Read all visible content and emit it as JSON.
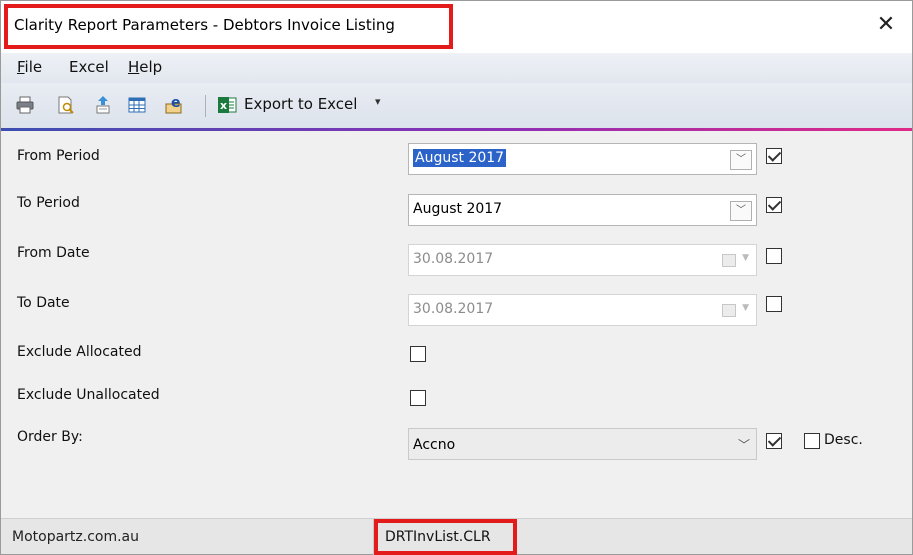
{
  "window": {
    "title": "Clarity Report Parameters - Debtors Invoice Listing",
    "close_glyph": "✕"
  },
  "menu": {
    "file": {
      "mnemonic": "F",
      "rest": "ile"
    },
    "excel": "Excel",
    "help": {
      "mnemonic": "H",
      "rest": "elp"
    }
  },
  "toolbar": {
    "icons": [
      "print-icon",
      "preview-icon",
      "export-icon",
      "grid-icon",
      "email-icon",
      "excel-icon"
    ],
    "export_label": "Export to Excel",
    "export_caret": "▾"
  },
  "fields": {
    "from_period": {
      "label": "From Period",
      "value": "August 2017",
      "checked": true
    },
    "to_period": {
      "label": "To Period",
      "value": "August 2017",
      "checked": true
    },
    "from_date": {
      "label": "From Date",
      "value": "30.08.2017",
      "checked": false
    },
    "to_date": {
      "label": "To Date",
      "value": "30.08.2017",
      "checked": false
    },
    "exclude_allocated": {
      "label": "Exclude Allocated",
      "checked": false
    },
    "exclude_unallocated": {
      "label": "Exclude Unallocated",
      "checked": false
    },
    "order_by": {
      "label": "Order By:",
      "value": "Accno",
      "checked": true,
      "desc_label": "Desc.",
      "desc_checked": false
    }
  },
  "status": {
    "company": "Motopartz.com.au",
    "file": "DRTInvList.CLR"
  },
  "colors": {
    "highlight_box": "#e31b1b",
    "selection": "#2b63c8",
    "accent_start": "#3c4fb0",
    "accent_end": "#e02a87"
  }
}
